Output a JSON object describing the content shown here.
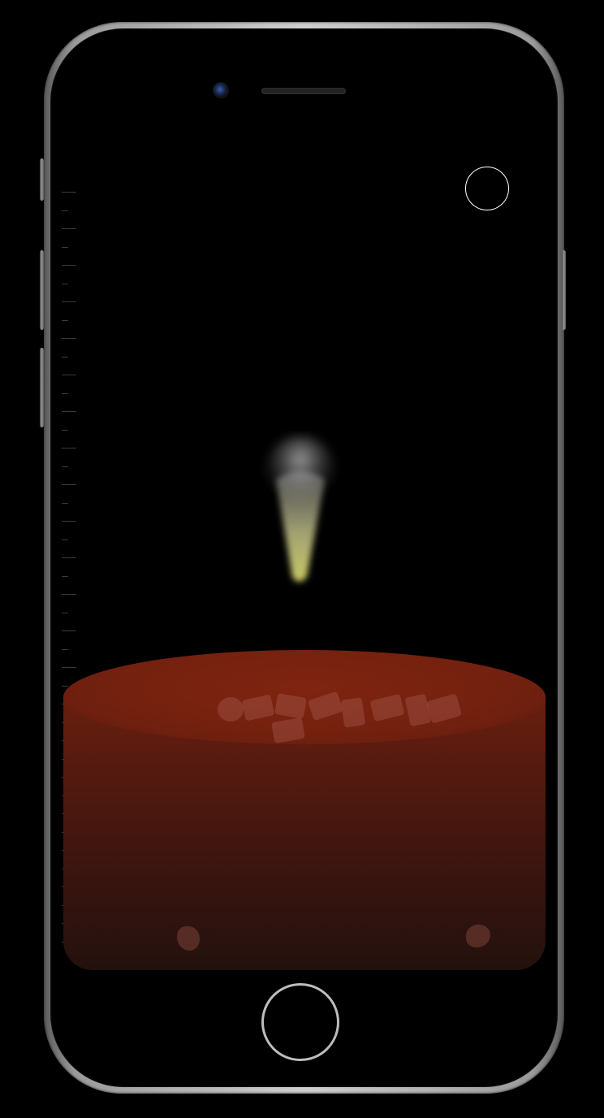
{
  "screen": {
    "record_button": {
      "shape": "circle",
      "icon": "record-circle-icon",
      "color": "#ffffff"
    },
    "liquid": {
      "surface_color": "#7a230f",
      "bottom_color": "#23110d"
    },
    "spray": {
      "color_top": "#bfbfbf",
      "color_bottom": "#d8d870"
    }
  }
}
